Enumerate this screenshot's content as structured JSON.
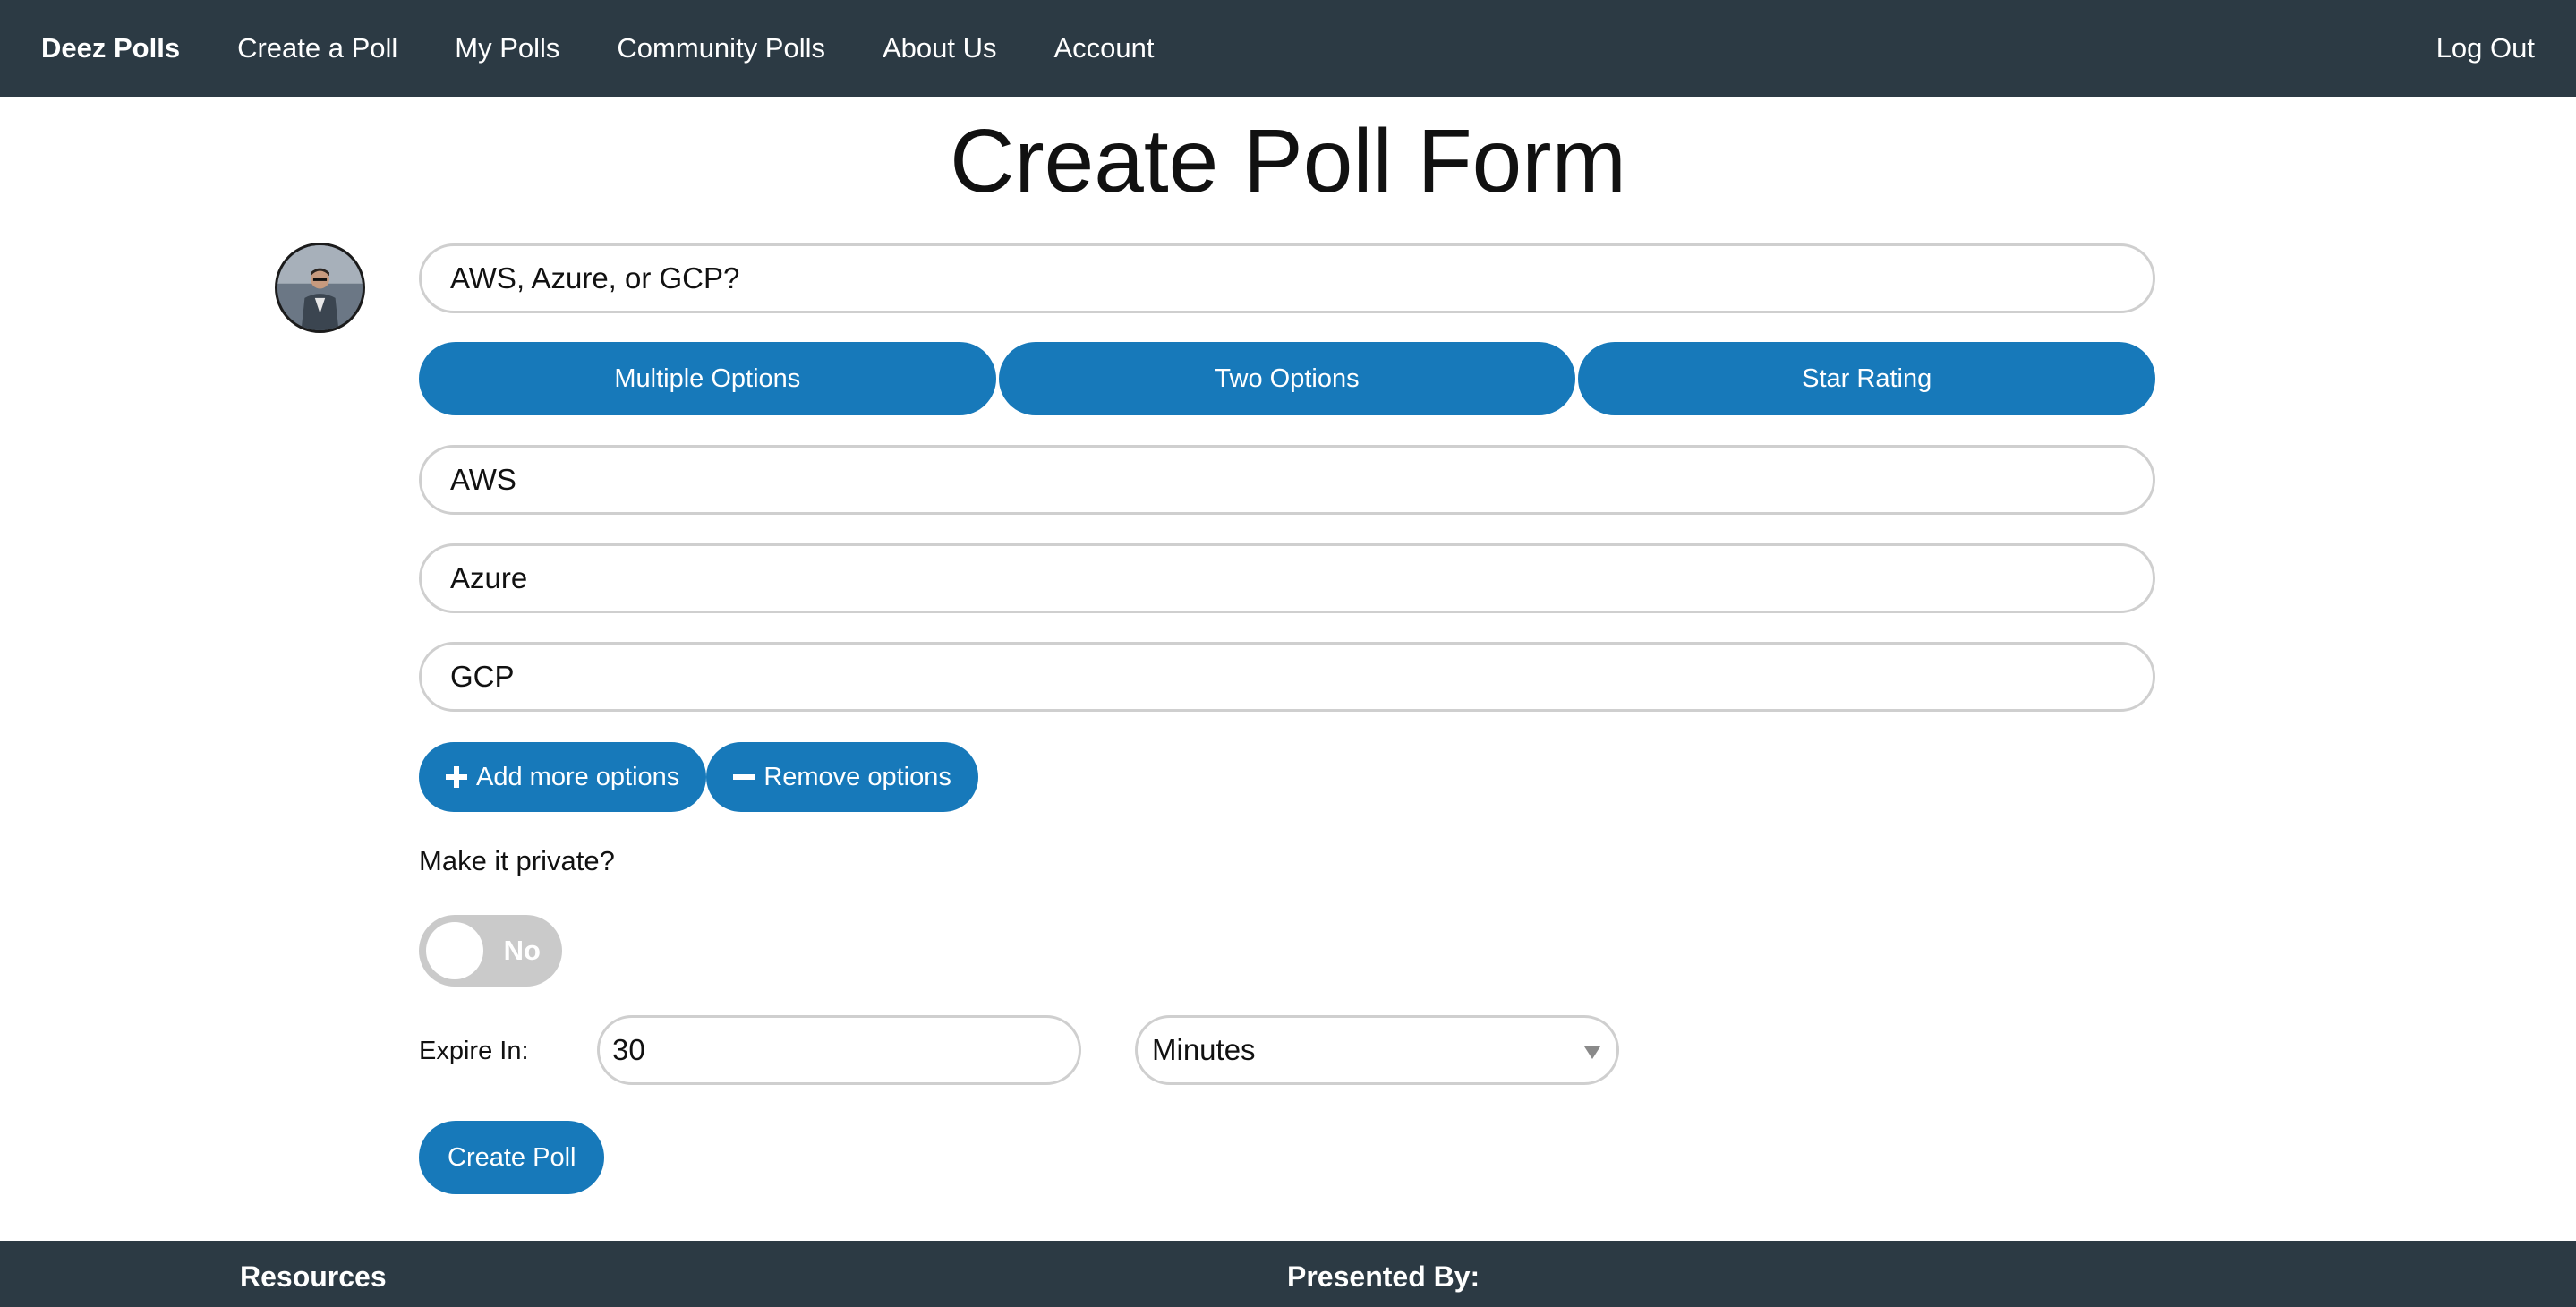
{
  "nav": {
    "brand": "Deez Polls",
    "items": [
      "Create a Poll",
      "My Polls",
      "Community Polls",
      "About Us",
      "Account"
    ],
    "logout": "Log Out"
  },
  "page": {
    "title": "Create Poll Form"
  },
  "avatar": {
    "icon": "user-avatar-photo"
  },
  "form": {
    "question": "AWS, Azure, or GCP?",
    "poll_types": [
      "Multiple Options",
      "Two Options",
      "Star Rating"
    ],
    "options": [
      "AWS",
      "Azure",
      "GCP"
    ],
    "add_label": "Add more options",
    "remove_label": "Remove options",
    "private_label": "Make it private?",
    "private_state": "No",
    "expire_label": "Expire In:",
    "expire_value": "30",
    "expire_unit": "Minutes",
    "submit_label": "Create Poll"
  },
  "footer": {
    "resources": "Resources",
    "presented_by": "Presented By:"
  },
  "colors": {
    "nav_bg": "#2c3a44",
    "primary": "#1779ba",
    "switch_off": "#cacaca"
  }
}
